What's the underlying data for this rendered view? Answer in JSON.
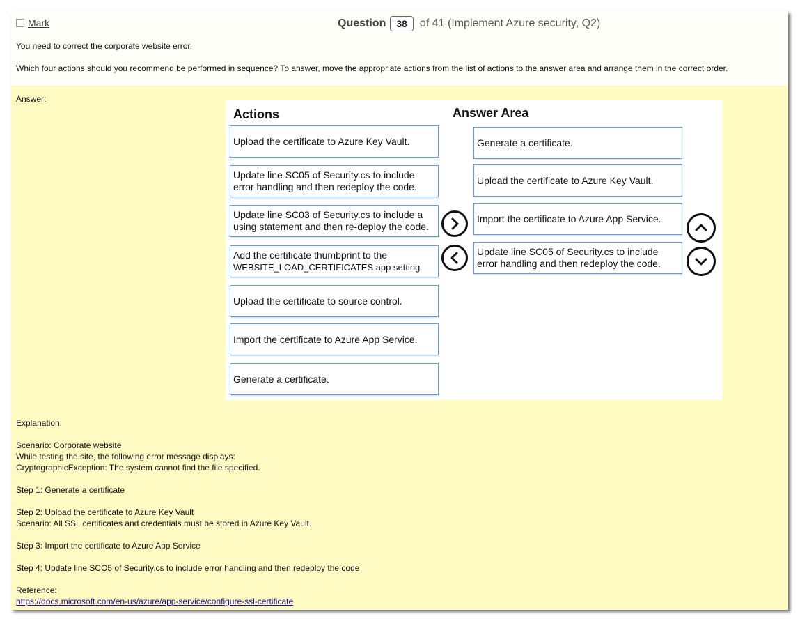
{
  "header": {
    "mark_label": "Mark",
    "question_word": "Question",
    "question_number": "38",
    "question_suffix": "of 41 (Implement Azure security, Q2)"
  },
  "prompt": {
    "line1": "You need to correct the corporate website error.",
    "line2": "Which four actions should you recommend be performed in sequence? To answer, move the appropriate actions from the list of actions to the answer area and arrange them in the correct order."
  },
  "answer_label": "Answer:",
  "actions": {
    "title": "Actions",
    "items": [
      {
        "text": "Upload the certificate to Azure Key Vault."
      },
      {
        "text": "Update line SC05 of Security.cs to include error handling and then redeploy the code."
      },
      {
        "text": "Update line SC03 of Security.cs to include a using statement and then re-deploy the code."
      },
      {
        "text": "Add the certificate thumbprint to the",
        "text2": "WEBSITE_LOAD_CERTIFICATES app setting."
      },
      {
        "text": "Upload the certificate to source control."
      },
      {
        "text": "Import the certificate to Azure App Service."
      },
      {
        "text": "Generate a certificate."
      }
    ]
  },
  "answer_area": {
    "title": "Answer Area",
    "items": [
      {
        "text": "Generate a certificate."
      },
      {
        "text": "Upload the certificate to Azure Key Vault."
      },
      {
        "text": "Import the certificate to Azure App Service."
      },
      {
        "text": "Update line SC05 of Security.cs to include error handling and then redeploy the code."
      }
    ]
  },
  "controls": {
    "move_right_icon": "chevron-right-icon",
    "move_left_icon": "chevron-left-icon",
    "move_up_icon": "chevron-up-icon",
    "move_down_icon": "chevron-down-icon"
  },
  "explanation": {
    "title": "Explanation:",
    "scenario": "Scenario: Corporate website",
    "line_testing": "While testing the site, the following error message displays:",
    "line_exception": "CryptographicException: The system cannot find the file specified.",
    "step1": "Step 1: Generate a certificate",
    "step2": "Step 2: Upload the certificate to Azure Key Vault",
    "step2_scenario": "Scenario: All SSL certificates and credentials must be stored in Azure Key Vault.",
    "step3": "Step 3: Import the certificate to Azure App Service",
    "step4": "Step 4: Update line SCO5 of Security.cs to include error handling and then redeploy the code",
    "reference_label": "Reference:",
    "reference_url": "https://docs.microsoft.com/en-us/azure/app-service/configure-ssl-certificate"
  },
  "colors": {
    "answer_background": "#fffbc3",
    "item_border": "#6b9bd1",
    "link": "#1a0dab"
  }
}
